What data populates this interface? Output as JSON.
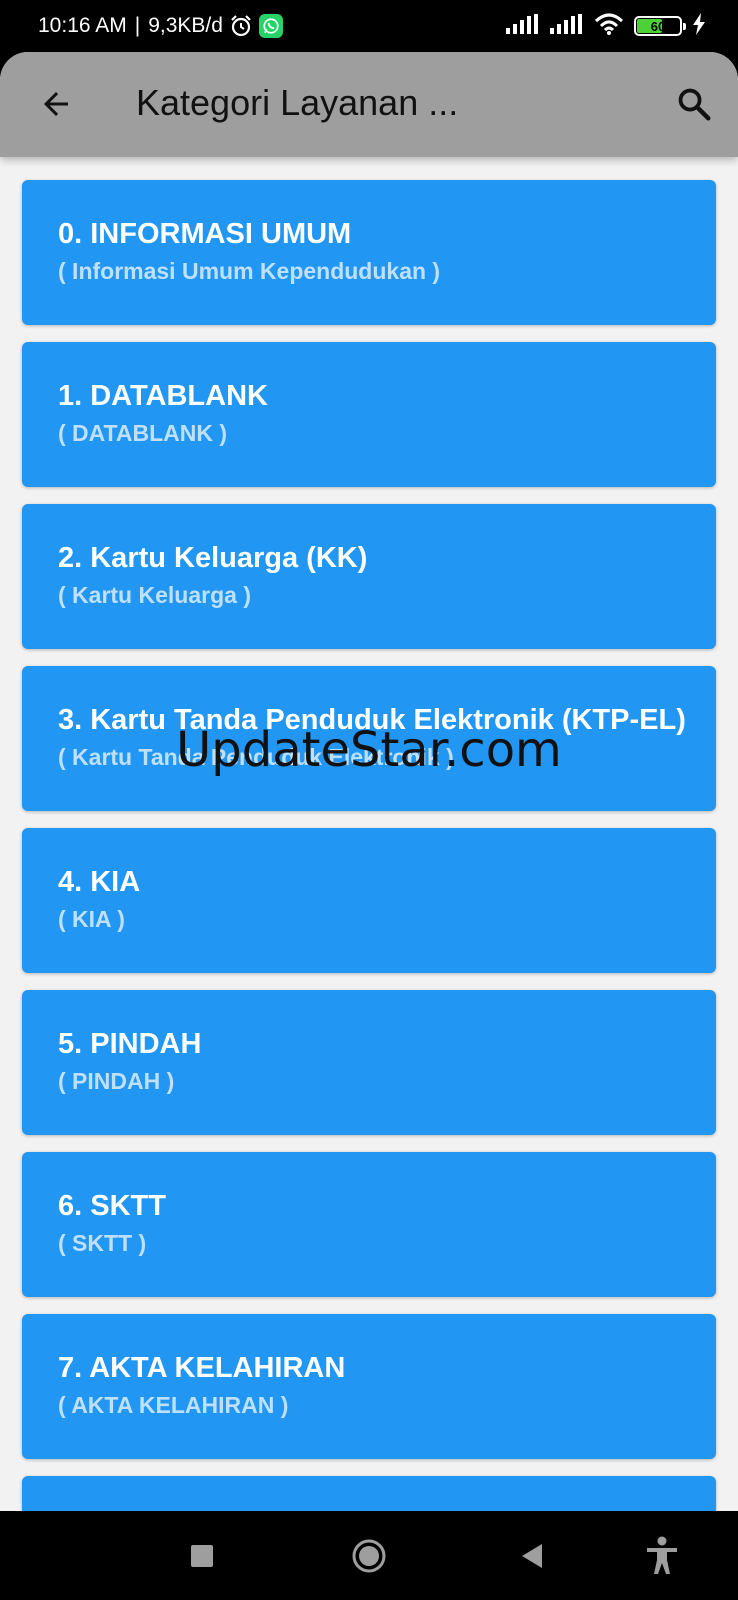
{
  "status_bar": {
    "time": "10:16 AM",
    "separator": "|",
    "speed": "9,3KB/d",
    "battery_level": "60",
    "battery_fraction": 0.6,
    "icons": [
      "alarm-icon",
      "whatsapp-icon",
      "signal-icon",
      "signal-icon",
      "wifi-icon",
      "battery-icon",
      "charging-icon"
    ]
  },
  "app_bar": {
    "title": "Kategori Layanan ...",
    "back_icon": "arrow-left-icon",
    "search_icon": "search-icon"
  },
  "colors": {
    "app_bar": "#9e9e9e",
    "card": "#2196f3",
    "card_subtitle": "#bfe0fb",
    "background": "#f2f2f2"
  },
  "categories": [
    {
      "title": "0. INFORMASI UMUM",
      "subtitle": "( Informasi Umum Kependudukan )"
    },
    {
      "title": "1. DATABLANK",
      "subtitle": "( DATABLANK )"
    },
    {
      "title": "2. Kartu Keluarga (KK)",
      "subtitle": "( Kartu Keluarga )"
    },
    {
      "title": "3. Kartu Tanda Penduduk Elektronik (KTP-EL)",
      "subtitle": "( Kartu Tanda Penduduk Elektronik )"
    },
    {
      "title": "4. KIA",
      "subtitle": "( KIA )"
    },
    {
      "title": "5. PINDAH",
      "subtitle": "( PINDAH )"
    },
    {
      "title": "6. SKTT",
      "subtitle": "( SKTT )"
    },
    {
      "title": "7. AKTA KELAHIRAN",
      "subtitle": "( AKTA KELAHIRAN )"
    },
    {
      "title": "",
      "subtitle": ""
    }
  ],
  "watermark": "UpdateStar.com",
  "nav_bar": {
    "icons": [
      "recents-icon",
      "home-icon",
      "back-icon",
      "accessibility-icon"
    ]
  }
}
